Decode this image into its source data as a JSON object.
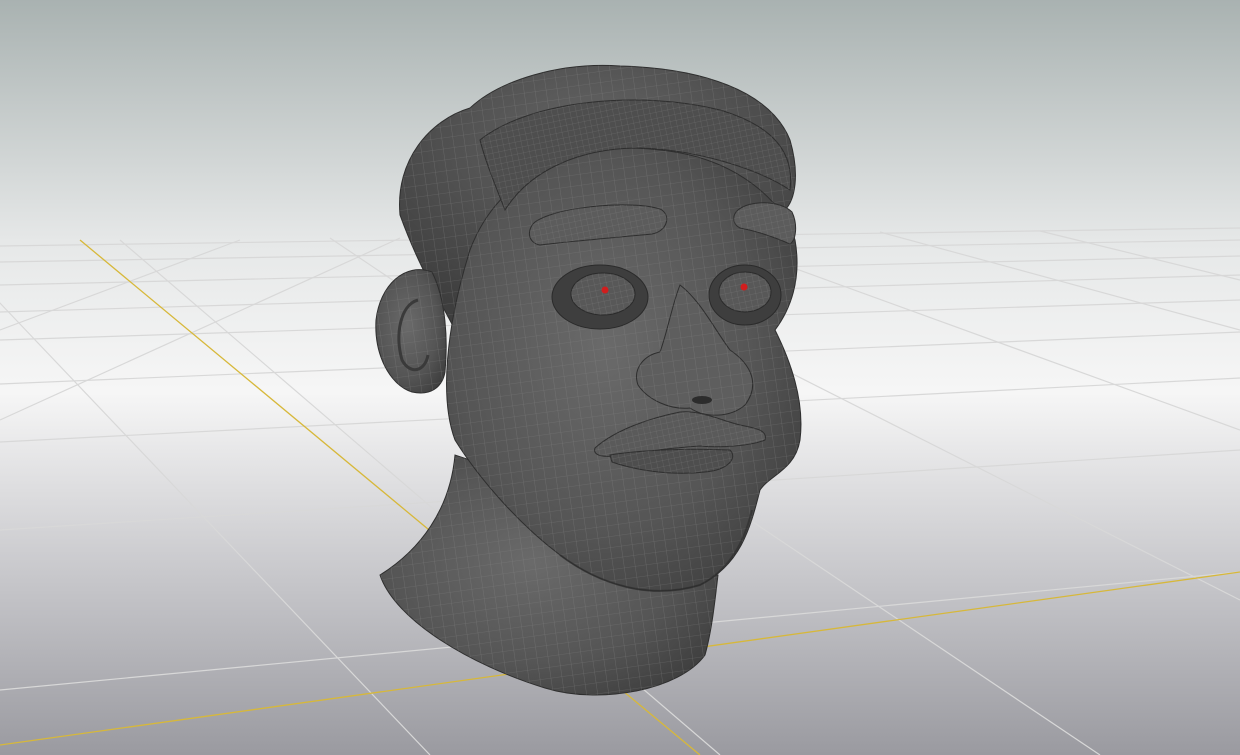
{
  "viewport": {
    "background_top": "#a9b2b1",
    "background_mid": "#f4f4f4",
    "background_bottom": "#9c9ca2",
    "grid_color": "#d8d8d8",
    "grid_axis_color": "#d7b83a"
  },
  "model": {
    "skin_color": "#565656",
    "wire_color": "#8a8a8a",
    "pupil_color": "#d01e1e"
  }
}
